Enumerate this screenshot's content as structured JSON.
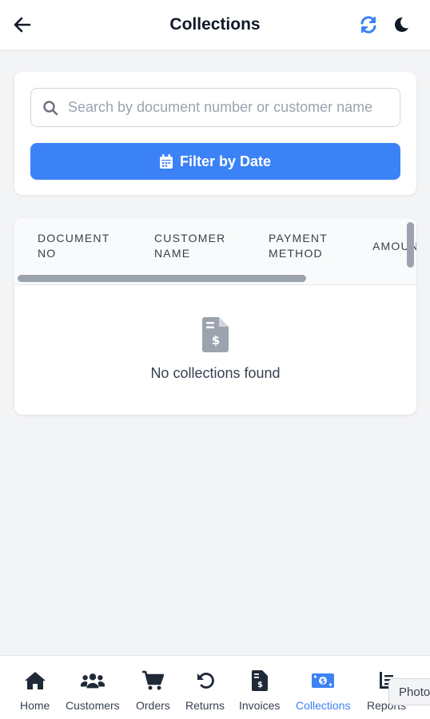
{
  "header": {
    "title": "Collections"
  },
  "search": {
    "placeholder": "Search by document number or customer name",
    "value": ""
  },
  "filter": {
    "label": "Filter by Date"
  },
  "table": {
    "columns": [
      "DOCUMENT\nNO",
      "CUSTOMER\nNAME",
      "PAYMENT\nMETHOD",
      "AMOUNT"
    ],
    "empty_text": "No collections found"
  },
  "nav": {
    "items": [
      {
        "label": "Home",
        "icon": "home-icon"
      },
      {
        "label": "Customers",
        "icon": "users-icon"
      },
      {
        "label": "Orders",
        "icon": "cart-icon"
      },
      {
        "label": "Returns",
        "icon": "undo-icon"
      },
      {
        "label": "Invoices",
        "icon": "invoice-icon"
      },
      {
        "label": "Collections",
        "icon": "money-icon"
      },
      {
        "label": "Reports",
        "icon": "report-icon"
      }
    ],
    "active": "Collections"
  },
  "tooltip": {
    "text": "Photo"
  },
  "colors": {
    "accent": "#3b82f6",
    "text": "#111827",
    "muted": "#9ca3af",
    "background": "#f3f4f6"
  }
}
